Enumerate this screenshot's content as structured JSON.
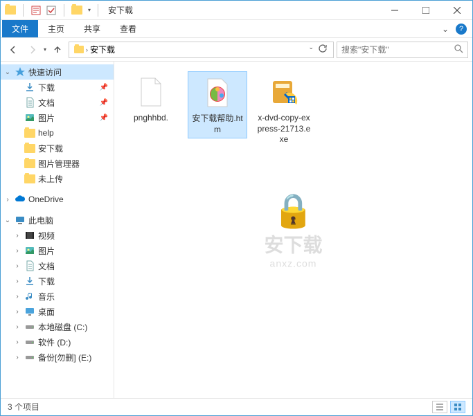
{
  "title": "安下载",
  "ribbon": {
    "tabs": [
      "文件",
      "主页",
      "共享",
      "查看"
    ],
    "active_index": 0
  },
  "address": {
    "segments": [
      "安下载"
    ],
    "search_placeholder": "搜索\"安下载\""
  },
  "sidebar": {
    "quick_access": "快速访问",
    "quick_items": [
      {
        "label": "下载",
        "icon": "download",
        "pinned": true
      },
      {
        "label": "文档",
        "icon": "document",
        "pinned": true
      },
      {
        "label": "图片",
        "icon": "picture",
        "pinned": true
      },
      {
        "label": "help",
        "icon": "folder",
        "pinned": false
      },
      {
        "label": "安下载",
        "icon": "folder",
        "pinned": false
      },
      {
        "label": "图片管理器",
        "icon": "folder",
        "pinned": false
      },
      {
        "label": "未上传",
        "icon": "folder",
        "pinned": false
      }
    ],
    "onedrive": "OneDrive",
    "this_pc": "此电脑",
    "pc_items": [
      {
        "label": "视频",
        "icon": "video"
      },
      {
        "label": "图片",
        "icon": "picture"
      },
      {
        "label": "文档",
        "icon": "document"
      },
      {
        "label": "下载",
        "icon": "download"
      },
      {
        "label": "音乐",
        "icon": "music"
      },
      {
        "label": "桌面",
        "icon": "desktop"
      },
      {
        "label": "本地磁盘 (C:)",
        "icon": "drive"
      },
      {
        "label": "软件 (D:)",
        "icon": "drive"
      },
      {
        "label": "备份[勿删] (E:)",
        "icon": "drive"
      }
    ]
  },
  "files": [
    {
      "name": "pnghhbd.",
      "type": "blank"
    },
    {
      "name": "安下载帮助.htm",
      "type": "htm",
      "selected": true
    },
    {
      "name": "x-dvd-copy-express-21713.exe",
      "type": "exe"
    }
  ],
  "statusbar": {
    "count": "3 个项目"
  },
  "watermark": {
    "text": "安下载",
    "sub": "anxz.com"
  }
}
